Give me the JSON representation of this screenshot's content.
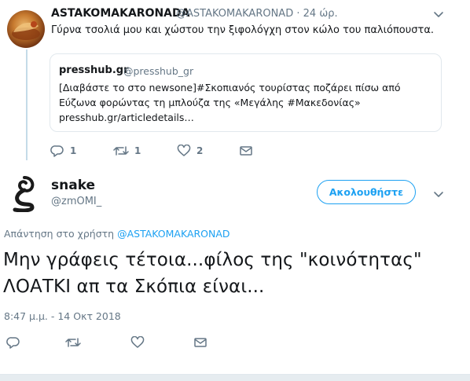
{
  "colors": {
    "link": "#1da1f2",
    "muted": "#657786",
    "text": "#14171a",
    "thread_line": "#c4dbe8"
  },
  "quoted_tweet": {
    "author_name": "ASTAKOMAKARONADA",
    "author_handle": "@ASTAKOMAKARONAD",
    "separator": "·",
    "time": "24 ώρ.",
    "text": "Γύρνα τσολιά μου και χώστου την ξιφολόγχη στον κώλο του παλιόπουστα.",
    "card": {
      "name": "presshub.gr",
      "handle": "@presshub_gr",
      "line1": "[Διαβάστε το στο newsone]#Σκοπιανός τουρίστας ποζάρει πίσω από",
      "line2": "Εύζωνα φορώντας τη μπλούζα της «Μεγάλης #Μακεδονίας»",
      "line3": "presshub.gr/articledetails…"
    },
    "actions": {
      "replies": "1",
      "retweets": "1",
      "likes": "2"
    }
  },
  "main_tweet": {
    "author_name": "snake",
    "author_handle": "@zmOMI_",
    "follow_label": "Ακολουθήστε",
    "reply_prefix": "Απάντηση στο χρήστη",
    "reply_mention": "@ASTAKOMAKARONAD",
    "text_line1": "Μην γράφεις τέτοια...φίλος της \"κοινότητας\"",
    "text_line2": "ΛΟΑΤΚΙ απ τα Σκόπια είναι...",
    "timestamp": "8:47 μ.μ. - 14 Οκτ 2018"
  },
  "icons": {
    "reply": "reply-icon",
    "retweet": "retweet-icon",
    "like": "heart-icon",
    "dm": "envelope-icon",
    "more": "chevron-down-icon"
  }
}
